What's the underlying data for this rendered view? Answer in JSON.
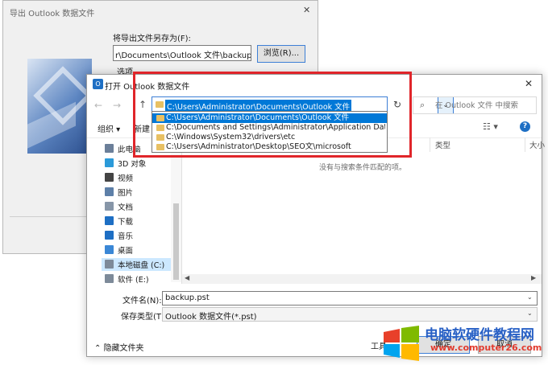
{
  "export_dialog": {
    "title": "导出 Outlook 数据文件",
    "close_glyph": "✕",
    "save_as_label": "将导出文件另存为(F):",
    "path_value": "r\\Documents\\Outlook 文件\\backup.pst",
    "browse_label": "浏览(R)...",
    "options_label": "选项"
  },
  "open_dialog": {
    "title": "打开 Outlook 数据文件",
    "app_icon": "O",
    "close_glyph": "✕",
    "address": "C:\\Users\\Administrator\\Documents\\Outlook 文件",
    "search_placeholder": "在 Outlook 文件 中搜索",
    "organize_label": "组织 ▾",
    "new_folder_label": "新建",
    "columns": {
      "type": "类型",
      "size": "大小"
    },
    "empty_message": "没有与搜索条件匹配的项。",
    "nav_items": [
      {
        "label": "此电脑",
        "icon": "pc-icon",
        "color": "#6b7f99"
      },
      {
        "label": "3D 对象",
        "icon": "cube-icon",
        "color": "#2b9ad9"
      },
      {
        "label": "视频",
        "icon": "video-icon",
        "color": "#444444"
      },
      {
        "label": "图片",
        "icon": "picture-icon",
        "color": "#5d7fa8"
      },
      {
        "label": "文档",
        "icon": "document-icon",
        "color": "#8796a8"
      },
      {
        "label": "下载",
        "icon": "download-icon",
        "color": "#1e6fc4"
      },
      {
        "label": "音乐",
        "icon": "music-icon",
        "color": "#1e6fc4"
      },
      {
        "label": "桌面",
        "icon": "desktop-icon",
        "color": "#3a87d6"
      },
      {
        "label": "本地磁盘 (C:)",
        "icon": "disk-icon",
        "color": "#7d8a99",
        "selected": true
      },
      {
        "label": "软件 (E:)",
        "icon": "disk-icon",
        "color": "#7d8a99"
      }
    ],
    "filename_label": "文件名(N):",
    "filename_value": "backup.pst",
    "filetype_label": "保存类型(T):",
    "filetype_value": "Outlook 数据文件(*.pst)",
    "hide_folders_label": "隐藏文件夹",
    "tools_label": "工具",
    "ok_label": "确定",
    "cancel_label": "取消"
  },
  "path_dropdown": {
    "items": [
      "C:\\Users\\Administrator\\Documents\\Outlook 文件",
      "C:\\Documents and Settings\\Administrator\\Application Data\\Mi",
      "C:\\Windows\\System32\\drivers\\etc",
      "C:\\Users\\Administrator\\Desktop\\SEO文\\microsoft"
    ],
    "selected_index": 0
  },
  "highlight_color": "#e0252a",
  "watermark": {
    "text": "电脑软硬件教程网",
    "url": "www.computer26.com"
  }
}
